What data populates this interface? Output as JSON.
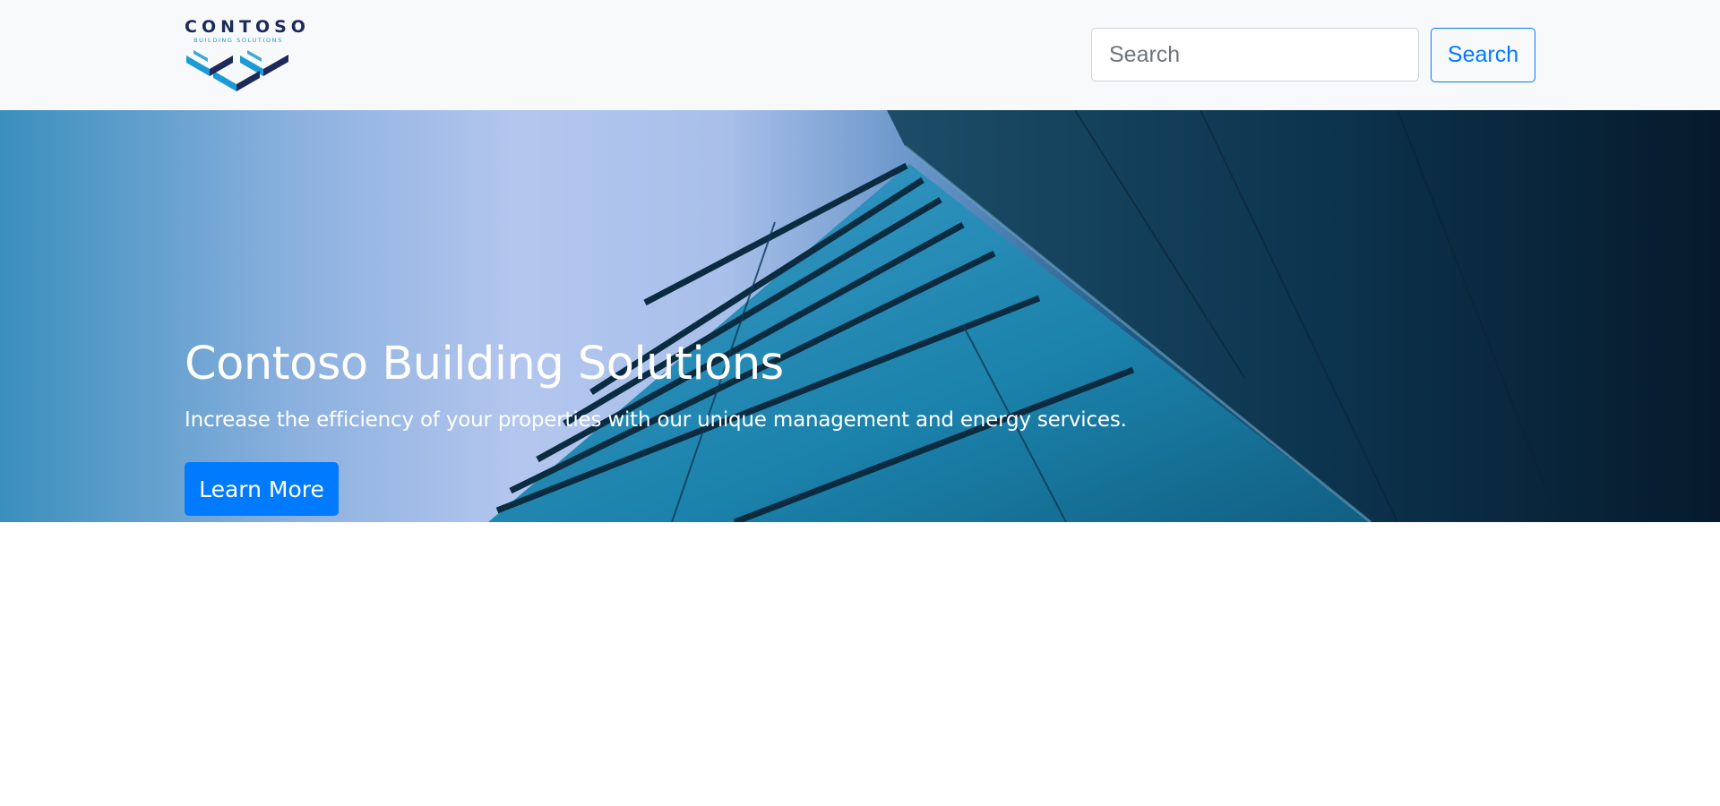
{
  "navbar": {
    "logo": {
      "word": "CONTOSO",
      "subtitle": "BUILDING SOLUTIONS",
      "icon": "contoso-chevron-logo",
      "colors": {
        "dark": "#1b2a5a",
        "light": "#1a9ad6"
      }
    },
    "search": {
      "placeholder": "Search",
      "value": "",
      "button_label": "Search"
    }
  },
  "hero": {
    "title": "Contoso Building Solutions",
    "subtitle": "Increase the efficiency of your properties with our unique management and energy services.",
    "cta_label": "Learn More",
    "background": "glass-building-photo"
  },
  "colors": {
    "accent": "#007bff",
    "navbar_bg": "#f8f9fa",
    "hero_text": "#ffffff"
  }
}
